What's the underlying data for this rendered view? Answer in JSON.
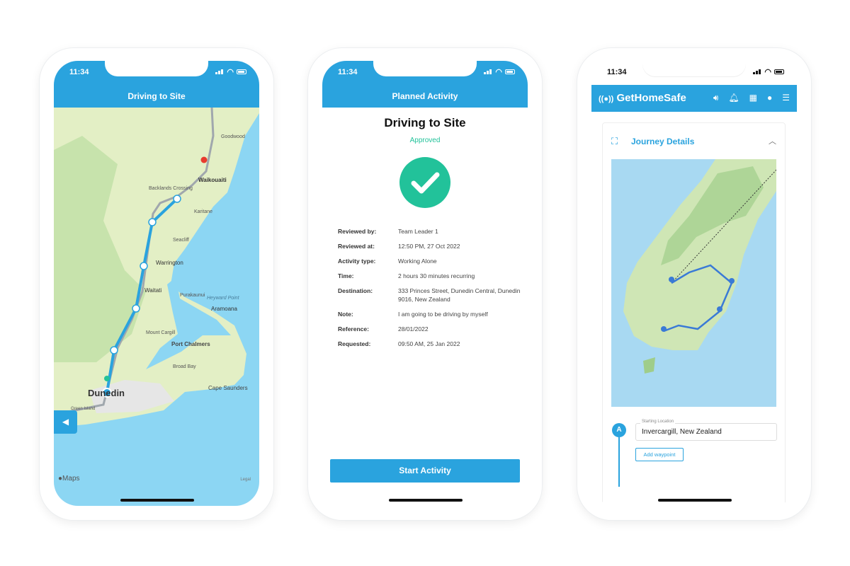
{
  "status": {
    "time": "11:34"
  },
  "left": {
    "title": "Driving to Site",
    "maps_brand": "Maps",
    "legal": "Legal",
    "places": [
      "Goodwood",
      "Waikouaiti",
      "Backlands Crossing",
      "Karitane",
      "Seacliff",
      "Warrington",
      "Waitati",
      "Purakaunui",
      "Heyward Point",
      "Aramoana",
      "Mount Cargill",
      "Port Chalmers",
      "Broad Bay",
      "Cape Saunders",
      "Dunedin",
      "Green Island"
    ]
  },
  "middle": {
    "header": "Planned Activity",
    "title": "Driving to Site",
    "status": "Approved",
    "details": [
      {
        "label": "Reviewed by:",
        "value": "Team Leader 1"
      },
      {
        "label": "Reviewed at:",
        "value": "12:50 PM, 27 Oct 2022"
      },
      {
        "label": "Activity type:",
        "value": "Working Alone"
      },
      {
        "label": "Time:",
        "value": "2 hours 30 minutes recurring"
      },
      {
        "label": "Destination:",
        "value": "333 Princes Street, Dunedin Central, Dunedin 9016, New Zealand"
      },
      {
        "label": "Note:",
        "value": "I am going to be driving by myself"
      },
      {
        "label": "Reference:",
        "value": "28/01/2022"
      },
      {
        "label": "Requested:",
        "value": "09:50 AM, 25 Jan 2022"
      }
    ],
    "start_button": "Start Activity"
  },
  "right": {
    "brand": "GetHomeSafe",
    "section": "Journey Details",
    "waypoint_marker": "A",
    "start_label": "Starting Location",
    "start_value": "Invercargill, New Zealand",
    "add_waypoint": "Add waypoint"
  },
  "colors": {
    "accent": "#2aa3de",
    "approved": "#22c29a"
  }
}
